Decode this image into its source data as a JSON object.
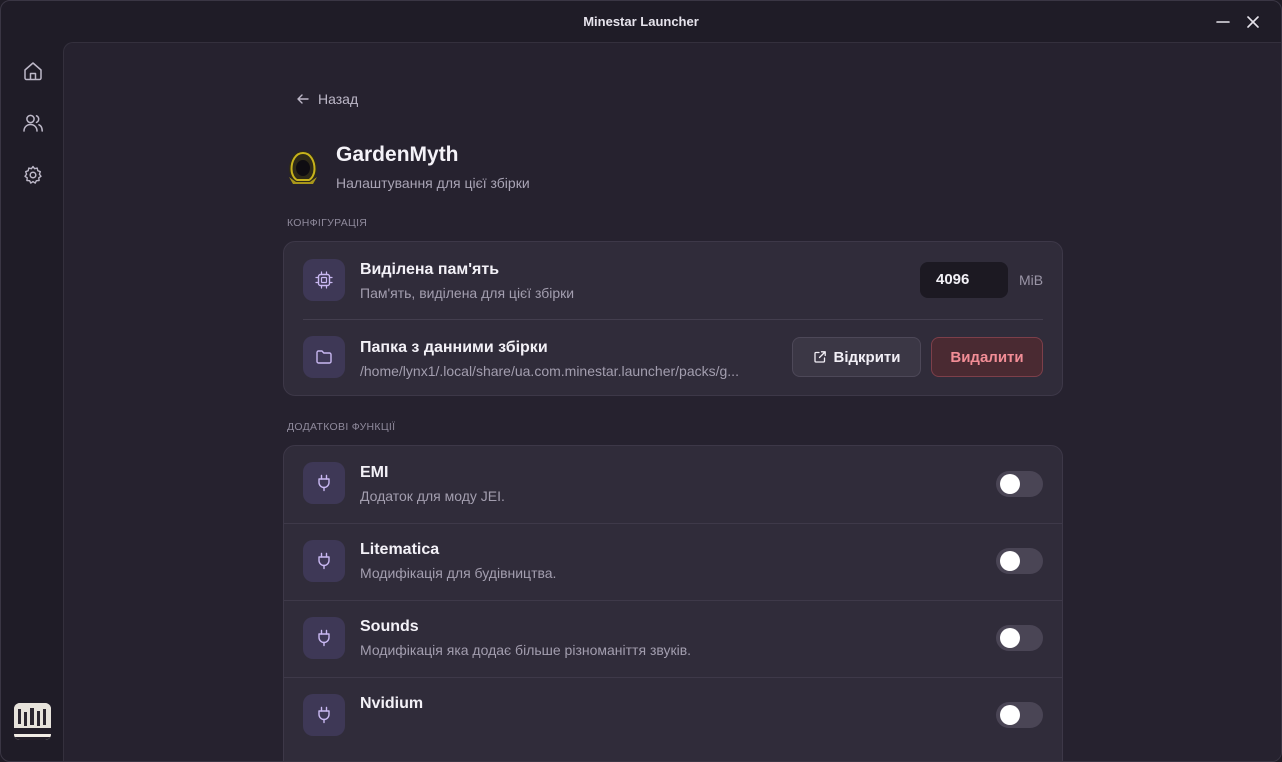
{
  "app": {
    "title": "Minestar Launcher"
  },
  "nav": {
    "back_label": "Назад"
  },
  "pack": {
    "name": "GardenMyth",
    "subtitle": "Налаштування для цієї збірки"
  },
  "sections": {
    "config_label": "Конфігурація",
    "extras_label": "Додаткові функції"
  },
  "config": {
    "memory": {
      "title": "Виділена пам'ять",
      "description": "Пам'ять, виділена для цієї збірки",
      "value": "4096",
      "unit": "MiB"
    },
    "folder": {
      "title": "Папка з данними збірки",
      "path": "/home/lynx1/.local/share/ua.com.minestar.launcher/packs/g...",
      "open_label": "Відкрити",
      "delete_label": "Видалити"
    }
  },
  "extras": [
    {
      "name": "EMI",
      "description": "Додаток для моду JEI.",
      "enabled": false
    },
    {
      "name": "Litematica",
      "description": "Модифікація для будівництва.",
      "enabled": false
    },
    {
      "name": "Sounds",
      "description": "Модифікація яка додає більше різноманіття звуків.",
      "enabled": false
    },
    {
      "name": "Nvidium",
      "description": "",
      "enabled": false
    }
  ],
  "icons": {
    "back": "arrow-left-icon",
    "home": "home-icon",
    "users": "users-icon",
    "settings": "gear-icon",
    "memory": "chip-icon",
    "folder": "folder-icon",
    "open": "external-link-icon",
    "plugin": "plug-icon"
  },
  "colors": {
    "accent": "#3e3856",
    "danger": "#f28d96",
    "background": "#26222f"
  }
}
